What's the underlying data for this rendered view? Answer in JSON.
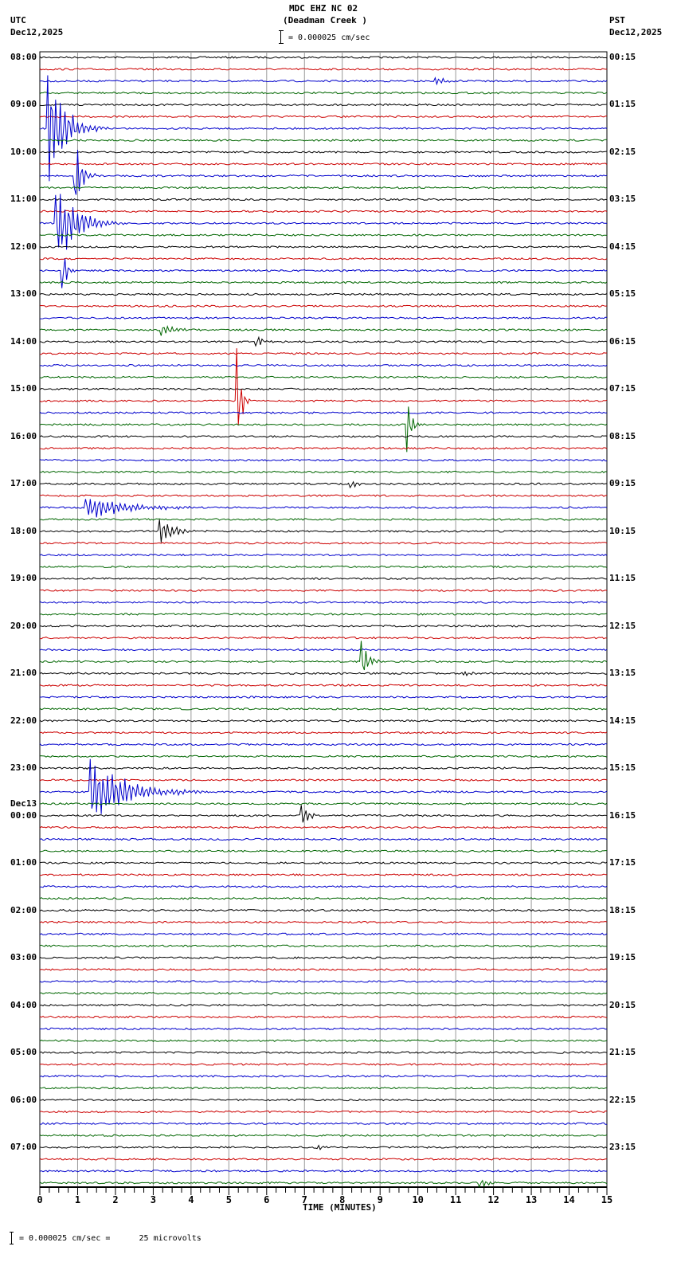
{
  "header": {
    "title": "MDC EHZ NC 02",
    "subtitle": "(Deadman Creek )",
    "left_tz": "UTC",
    "left_date": "Dec12,2025",
    "right_tz": "PST",
    "right_date": "Dec12,2025",
    "scale": "= 0.000025 cm/sec"
  },
  "footer": {
    "scale": "= 0.000025 cm/sec =      25 microvolts"
  },
  "chart_data": {
    "type": "line",
    "title": "MDC EHZ NC 02 (Deadman Creek )",
    "xlabel": "TIME (MINUTES)",
    "xlim": [
      0,
      15
    ],
    "x_ticks": [
      "0",
      "1",
      "2",
      "3",
      "4",
      "5",
      "6",
      "7",
      "8",
      "9",
      "10",
      "11",
      "12",
      "13",
      "14",
      "15"
    ],
    "trace_minutes": 15,
    "trace_count": 96,
    "trace_colors": [
      "#000000",
      "#cc0000",
      "#0000cc",
      "#006600"
    ],
    "left_labels": [
      "08:00",
      "09:00",
      "10:00",
      "11:00",
      "12:00",
      "13:00",
      "14:00",
      "15:00",
      "16:00",
      "17:00",
      "18:00",
      "19:00",
      "20:00",
      "21:00",
      "22:00",
      "23:00",
      "00:00",
      "01:00",
      "02:00",
      "03:00",
      "04:00",
      "05:00",
      "06:00",
      "07:00"
    ],
    "left_date_change": "Dec13",
    "right_labels": [
      "00:15",
      "01:15",
      "02:15",
      "03:15",
      "04:15",
      "05:15",
      "06:15",
      "07:15",
      "08:15",
      "09:15",
      "10:15",
      "11:15",
      "12:15",
      "13:15",
      "14:15",
      "15:15",
      "16:15",
      "17:15",
      "18:15",
      "19:15",
      "20:15",
      "21:15",
      "22:15",
      "23:15"
    ],
    "events": [
      {
        "trace": 2,
        "minute": 10.4,
        "amp": 0.4,
        "dur": 0.6
      },
      {
        "trace": 6,
        "minute": 0.2,
        "amp": 6,
        "dur": 0.8
      },
      {
        "trace": 10,
        "minute": 0.9,
        "amp": 5,
        "dur": 0.3
      },
      {
        "trace": 14,
        "minute": 0.4,
        "amp": 4,
        "dur": 1.0
      },
      {
        "trace": 18,
        "minute": 0.55,
        "amp": 4,
        "dur": 0.2
      },
      {
        "trace": 23,
        "minute": 3.2,
        "amp": 0.5,
        "dur": 0.8
      },
      {
        "trace": 24,
        "minute": 5.7,
        "amp": 0.8,
        "dur": 0.3
      },
      {
        "trace": 29,
        "minute": 5.2,
        "amp": 6,
        "dur": 0.2
      },
      {
        "trace": 31,
        "minute": 9.7,
        "amp": 3.5,
        "dur": 0.2
      },
      {
        "trace": 36,
        "minute": 8.2,
        "amp": 0.6,
        "dur": 0.3
      },
      {
        "trace": 38,
        "minute": 1.2,
        "amp": 1.2,
        "dur": 1.8
      },
      {
        "trace": 40,
        "minute": 3.15,
        "amp": 1.3,
        "dur": 0.7
      },
      {
        "trace": 51,
        "minute": 8.5,
        "amp": 2.2,
        "dur": 0.3
      },
      {
        "trace": 52,
        "minute": 11.2,
        "amp": 0.5,
        "dur": 0.3
      },
      {
        "trace": 62,
        "minute": 1.3,
        "amp": 3.5,
        "dur": 1.6
      },
      {
        "trace": 64,
        "minute": 6.9,
        "amp": 1.6,
        "dur": 0.3
      },
      {
        "trace": 92,
        "minute": 7.3,
        "amp": 0.4,
        "dur": 0.3
      },
      {
        "trace": 95,
        "minute": 11.6,
        "amp": 0.5,
        "dur": 0.4
      }
    ]
  }
}
